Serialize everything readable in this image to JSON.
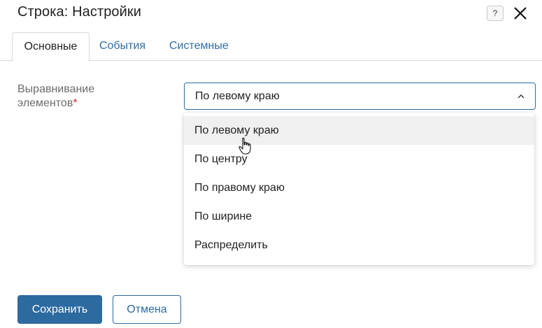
{
  "dialog": {
    "title": "Строка: Настройки",
    "help_icon": "question-icon",
    "close_icon": "close-icon"
  },
  "tabs": [
    {
      "label": "Основные",
      "active": true
    },
    {
      "label": "События",
      "active": false
    },
    {
      "label": "Системные",
      "active": false
    }
  ],
  "field": {
    "label": "Выравнивание элементов",
    "required_mark": "*",
    "selected_value": "По левому краю",
    "chevron_icon": "chevron-up-icon",
    "options": [
      {
        "label": "По левому краю",
        "hovered": true
      },
      {
        "label": "По центру",
        "hovered": false
      },
      {
        "label": "По правому краю",
        "hovered": false
      },
      {
        "label": "По ширине",
        "hovered": false
      },
      {
        "label": "Распределить",
        "hovered": false
      }
    ]
  },
  "actions": {
    "save_label": "Сохранить",
    "cancel_label": "Отмена"
  },
  "colors": {
    "accent": "#2c6aa0",
    "tab_link": "#2e6da4",
    "required": "#d0312d",
    "hover_bg": "#f0f0f0"
  }
}
